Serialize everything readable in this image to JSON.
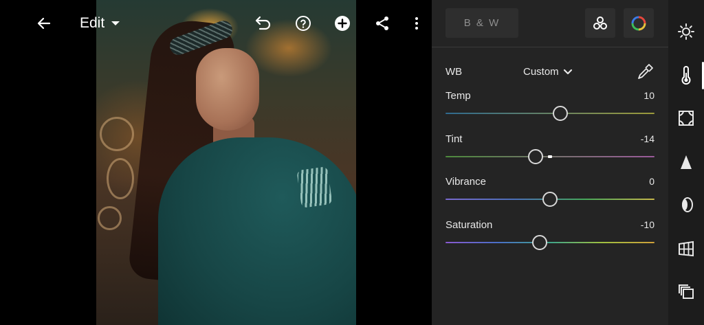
{
  "toolbar": {
    "edit_label": "Edit",
    "icons": [
      "back-arrow-icon",
      "undo-icon",
      "help-icon",
      "add-icon",
      "share-icon",
      "more-icon"
    ]
  },
  "panel": {
    "bw_label": "B & W",
    "wb": {
      "label": "WB",
      "value": "Custom"
    },
    "sliders": [
      {
        "label": "Temp",
        "value": "10",
        "position": 0.55,
        "gradient": [
          "#2f6a8f",
          "#9c9a3a"
        ]
      },
      {
        "label": "Tint",
        "value": "-14",
        "position": 0.43,
        "default_position": 0.49,
        "gradient": [
          "#4d8a3c",
          "#9b5a9b"
        ]
      },
      {
        "label": "Vibrance",
        "value": "0",
        "position": 0.5,
        "gradient": [
          "#7a6ad0",
          "#4a6fb8",
          "#46a85a",
          "#c8b84a"
        ]
      },
      {
        "label": "Saturation",
        "value": "-10",
        "position": 0.45,
        "gradient": [
          "#8a5ad0",
          "#4a6fc8",
          "#3fa58a",
          "#a0c040",
          "#d0a03a"
        ]
      }
    ]
  },
  "rail": {
    "icons": [
      "light-icon",
      "color-temperature-icon",
      "effects-icon",
      "detail-icon",
      "optics-icon",
      "geometry-icon",
      "versions-icon"
    ],
    "active_index": 1
  },
  "colors": {
    "panel_bg": "#242424",
    "rail_bg": "#1c1c1c",
    "button_bg": "#2e2e2e",
    "text": "#e8e8e8"
  }
}
